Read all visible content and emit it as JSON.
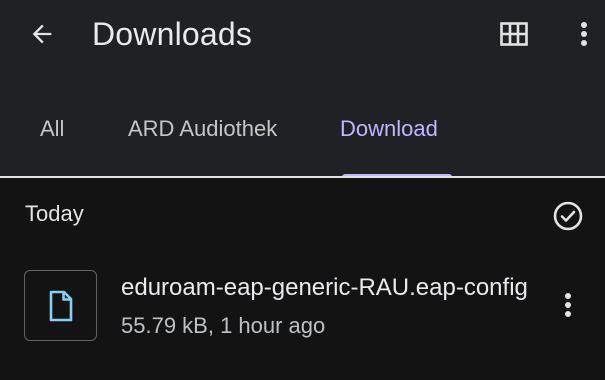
{
  "app": {
    "title": "Downloads",
    "back_icon": "arrow-left-icon",
    "grid_icon": "grid-view-icon",
    "more_icon": "more-vert-icon"
  },
  "tabs": [
    {
      "label": "All",
      "active": false
    },
    {
      "label": "ARD Audiothek",
      "active": false
    },
    {
      "label": "Download",
      "active": true
    }
  ],
  "section": {
    "title": "Today",
    "select_icon": "check-circle-icon"
  },
  "files": [
    {
      "name": "eduroam-eap-generic-RAU.eap-config",
      "meta": "55.79 kB, 1 hour ago",
      "icon": "file-icon"
    }
  ],
  "colors": {
    "background": "#131314",
    "toolbar": "#202124",
    "accent": "#c2b5ff",
    "file_icon": "#7fd3f0"
  }
}
